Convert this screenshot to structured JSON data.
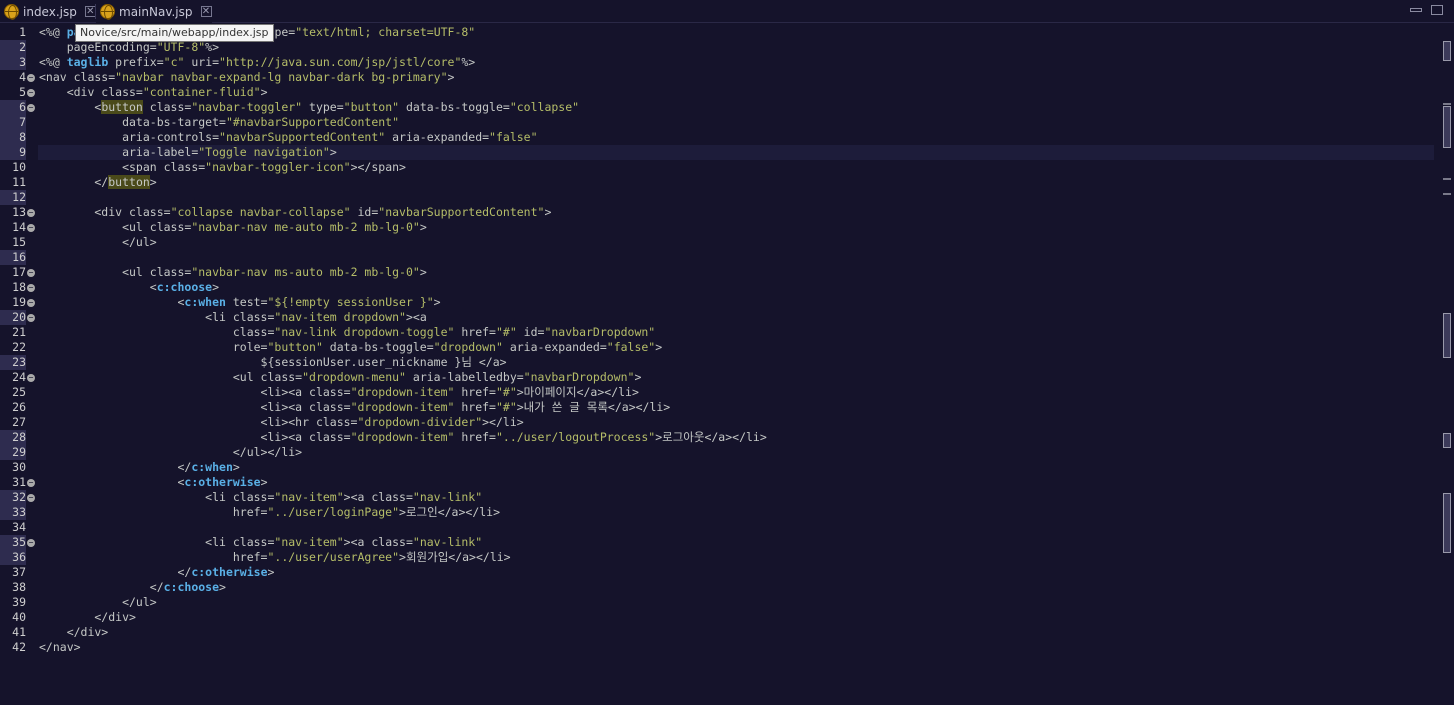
{
  "tabs": [
    {
      "label": "index.jsp",
      "icon": "globe-icon"
    },
    {
      "label": "mainNav.jsp",
      "icon": "globe-icon"
    }
  ],
  "tooltip": "Novice/src/main/webapp/index.jsp",
  "window_controls": {
    "minimize": "minimize-icon",
    "maximize": "maximize-icon"
  },
  "colors": {
    "background": "#15132b",
    "keyword": "#5ab0e6",
    "string": "#b5bd68"
  },
  "lines": [
    {
      "n": "1",
      "text": "<%@ page language=\"java\" contentType=\"text/html; charset=UTF-8\""
    },
    {
      "n": "2",
      "text": "    pageEncoding=\"UTF-8\"%>"
    },
    {
      "n": "3",
      "text": "<%@ taglib prefix=\"c\" uri=\"http://java.sun.com/jsp/jstl/core\"%>"
    },
    {
      "n": "4",
      "text": "<nav class=\"navbar navbar-expand-lg navbar-dark bg-primary\">"
    },
    {
      "n": "5",
      "text": "    <div class=\"container-fluid\">"
    },
    {
      "n": "6",
      "text": "        <button class=\"navbar-toggler\" type=\"button\" data-bs-toggle=\"collapse\""
    },
    {
      "n": "7",
      "text": "            data-bs-target=\"#navbarSupportedContent\""
    },
    {
      "n": "8",
      "text": "            aria-controls=\"navbarSupportedContent\" aria-expanded=\"false\""
    },
    {
      "n": "9",
      "text": "            aria-label=\"Toggle navigation\">"
    },
    {
      "n": "10",
      "text": "            <span class=\"navbar-toggler-icon\"></span>"
    },
    {
      "n": "11",
      "text": "        </button>"
    },
    {
      "n": "12",
      "text": ""
    },
    {
      "n": "13",
      "text": "        <div class=\"collapse navbar-collapse\" id=\"navbarSupportedContent\">"
    },
    {
      "n": "14",
      "text": "            <ul class=\"navbar-nav me-auto mb-2 mb-lg-0\">"
    },
    {
      "n": "15",
      "text": "            </ul>"
    },
    {
      "n": "16",
      "text": ""
    },
    {
      "n": "17",
      "text": "            <ul class=\"navbar-nav ms-auto mb-2 mb-lg-0\">"
    },
    {
      "n": "18",
      "text": "                <c:choose>"
    },
    {
      "n": "19",
      "text": "                    <c:when test=\"${!empty sessionUser }\">"
    },
    {
      "n": "20",
      "text": "                        <li class=\"nav-item dropdown\"><a"
    },
    {
      "n": "21",
      "text": "                            class=\"nav-link dropdown-toggle\" href=\"#\" id=\"navbarDropdown\""
    },
    {
      "n": "22",
      "text": "                            role=\"button\" data-bs-toggle=\"dropdown\" aria-expanded=\"false\">"
    },
    {
      "n": "23",
      "text": "                                ${sessionUser.user_nickname }님 </a>"
    },
    {
      "n": "24",
      "text": "                            <ul class=\"dropdown-menu\" aria-labelledby=\"navbarDropdown\">"
    },
    {
      "n": "25",
      "text": "                                <li><a class=\"dropdown-item\" href=\"#\">마이페이지</a></li>"
    },
    {
      "n": "26",
      "text": "                                <li><a class=\"dropdown-item\" href=\"#\">내가 쓴 글 목록</a></li>"
    },
    {
      "n": "27",
      "text": "                                <li><hr class=\"dropdown-divider\"></li>"
    },
    {
      "n": "28",
      "text": "                                <li><a class=\"dropdown-item\" href=\"../user/logoutProcess\">로그아웃</a></li>"
    },
    {
      "n": "29",
      "text": "                            </ul></li>"
    },
    {
      "n": "30",
      "text": "                    </c:when>"
    },
    {
      "n": "31",
      "text": "                    <c:otherwise>"
    },
    {
      "n": "32",
      "text": "                        <li class=\"nav-item\"><a class=\"nav-link\""
    },
    {
      "n": "33",
      "text": "                            href=\"../user/loginPage\">로그인</a></li>"
    },
    {
      "n": "34",
      "text": ""
    },
    {
      "n": "35",
      "text": "                        <li class=\"nav-item\"><a class=\"nav-link\""
    },
    {
      "n": "36",
      "text": "                            href=\"../user/userAgree\">회원가입</a></li>"
    },
    {
      "n": "37",
      "text": "                    </c:otherwise>"
    },
    {
      "n": "38",
      "text": "                </c:choose>"
    },
    {
      "n": "39",
      "text": "            </ul>"
    },
    {
      "n": "40",
      "text": "        </div>"
    },
    {
      "n": "41",
      "text": "    </div>"
    },
    {
      "n": "42",
      "text": "</nav>"
    }
  ]
}
